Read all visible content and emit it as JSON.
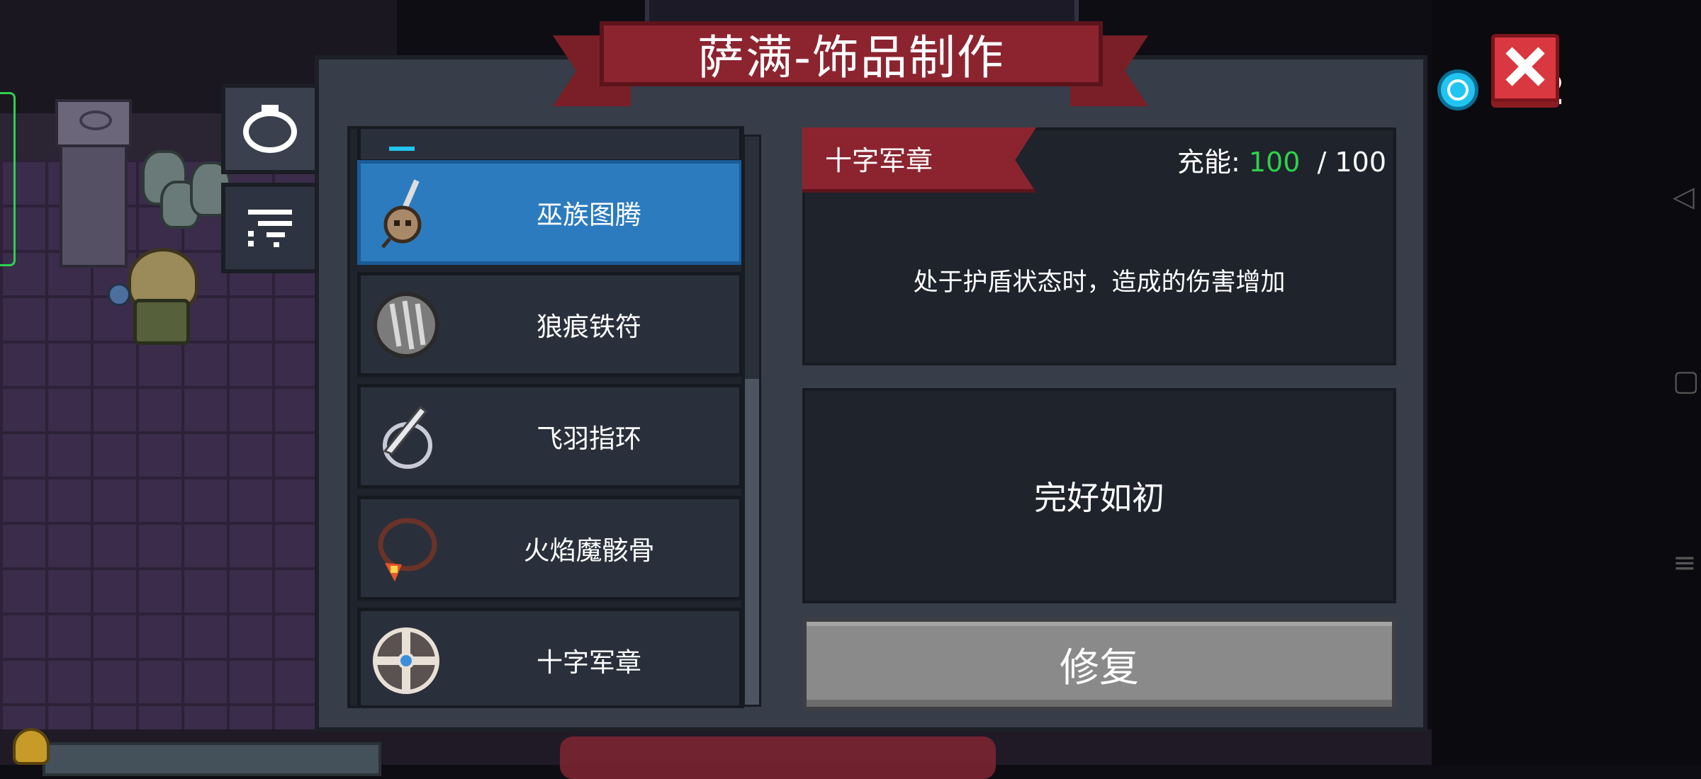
{
  "title": "萨满-饰品制作",
  "counter": "12",
  "tabs": [
    {
      "icon": "ring-icon",
      "active": true
    },
    {
      "icon": "filter-icon",
      "active": false
    }
  ],
  "items": [
    {
      "name": "巫族图腾",
      "icon": "totem-icon",
      "selected": true
    },
    {
      "name": "狼痕铁符",
      "icon": "claw-medal-icon",
      "selected": false
    },
    {
      "name": "飞羽指环",
      "icon": "feather-ring-icon",
      "selected": false
    },
    {
      "name": "火焰魔骸骨",
      "icon": "bone-necklace-icon",
      "selected": false
    },
    {
      "name": "十字军章",
      "icon": "cross-badge-icon",
      "selected": false
    }
  ],
  "detail": {
    "name": "十字军章",
    "charge_label": "充能:",
    "charge_current": "100",
    "charge_max": "/ 100",
    "description": "处于护盾状态时，造成的伤害增加",
    "state": "完好如初",
    "action_label": "修复"
  },
  "colors": {
    "accent_red": "#8c2430",
    "selected_blue": "#2c7bbf",
    "charge_green": "#2fd24a"
  }
}
